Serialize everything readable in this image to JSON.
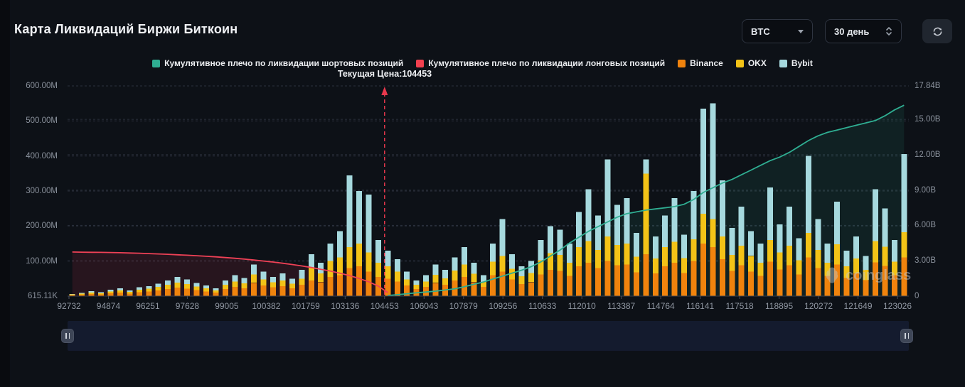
{
  "header": {
    "title": "Карта Ликвидаций Биржи Биткоин"
  },
  "controls": {
    "coin_value": "BTC",
    "period_value": "30 день",
    "refresh_icon": "refresh-icon"
  },
  "legend": [
    {
      "id": "cum-short",
      "label": "Кумулятивное плечо по ликвидации шортовых позиций",
      "color": "#2fae92"
    },
    {
      "id": "cum-long",
      "label": "Кумулятивное плечо по ликвидации лонговых позиций",
      "color": "#f2404f"
    },
    {
      "id": "binance",
      "label": "Binance",
      "color": "#f0830d"
    },
    {
      "id": "okx",
      "label": "OKX",
      "color": "#f3c317"
    },
    {
      "id": "bybit",
      "label": "Bybit",
      "color": "#a6d9de"
    }
  ],
  "annotation": {
    "current_price_label": "Текущая Цена:104453",
    "current_price": 104453
  },
  "watermark": {
    "text": "coinglass"
  },
  "chart_data": {
    "type": "bar",
    "note": "stacked liquidation bars (left axis, millions USD) + cumulative leverage lines (right axis, billions USD)",
    "x_labels": [
      "92732",
      "94874",
      "96251",
      "97628",
      "99005",
      "100382",
      "101759",
      "103136",
      "104453",
      "106043",
      "107879",
      "109256",
      "110633",
      "112010",
      "113387",
      "114764",
      "116141",
      "117518",
      "118895",
      "120272",
      "121649",
      "123026"
    ],
    "left_axis": {
      "max_m": 600,
      "ticks": [
        {
          "label": "600.00M",
          "value": 600,
          "grid": true
        },
        {
          "label": "500.00M",
          "value": 500,
          "grid": true
        },
        {
          "label": "400.00M",
          "value": 400,
          "grid": true
        },
        {
          "label": "300.00M",
          "value": 300,
          "grid": true
        },
        {
          "label": "200.00M",
          "value": 200,
          "grid": true
        },
        {
          "label": "100.00M",
          "value": 100,
          "grid": true
        },
        {
          "label": "615.11K",
          "value": 0.615,
          "grid": false
        }
      ]
    },
    "right_axis": {
      "max_b": 17.84,
      "ticks": [
        {
          "label": "17.84B",
          "value": 17.84,
          "grid": false
        },
        {
          "label": "15.00B",
          "value": 15,
          "grid": true
        },
        {
          "label": "12.00B",
          "value": 12,
          "grid": true
        },
        {
          "label": "9.00B",
          "value": 9,
          "grid": true
        },
        {
          "label": "6.00B",
          "value": 6,
          "grid": true
        },
        {
          "label": "3.00B",
          "value": 3,
          "grid": true
        },
        {
          "label": "0",
          "value": 0,
          "grid": false
        }
      ]
    },
    "price_line": {
      "label_index": 8,
      "color": "#e8384d"
    },
    "series": [
      {
        "name": "Binance",
        "color": "#f0830d",
        "unit": "M",
        "values": [
          3,
          4,
          6,
          5,
          8,
          10,
          7,
          11,
          13,
          16,
          20,
          24,
          21,
          17,
          13,
          10,
          20,
          26,
          22,
          38,
          30,
          25,
          28,
          22,
          32,
          45,
          40,
          55,
          60,
          80,
          85,
          70,
          55,
          50,
          42,
          30,
          20,
          26,
          38,
          32,
          45,
          55,
          40,
          26,
          60,
          70,
          48,
          35,
          40,
          62,
          75,
          72,
          58,
          85,
          95,
          80,
          100,
          88,
          90,
          68,
          120,
          65,
          85,
          95,
          66,
          100,
          150,
          140,
          105,
          72,
          88,
          70,
          58,
          98,
          76,
          88,
          62,
          110,
          80,
          58,
          90,
          52,
          65,
          46,
          96,
          86,
          60,
          110
        ]
      },
      {
        "name": "OKX",
        "color": "#f3c317",
        "unit": "M",
        "values": [
          2,
          3,
          4,
          3,
          5,
          6,
          5,
          7,
          8,
          10,
          12,
          15,
          13,
          10,
          9,
          6,
          12,
          16,
          14,
          24,
          18,
          15,
          17,
          13,
          18,
          35,
          25,
          45,
          50,
          60,
          65,
          55,
          40,
          35,
          28,
          18,
          12,
          16,
          23,
          19,
          28,
          35,
          24,
          15,
          38,
          45,
          30,
          22,
          26,
          40,
          48,
          46,
          37,
          55,
          62,
          52,
          70,
          58,
          60,
          45,
          230,
          42,
          55,
          60,
          43,
          62,
          85,
          80,
          65,
          46,
          56,
          45,
          37,
          62,
          49,
          56,
          40,
          70,
          52,
          37,
          58,
          33,
          42,
          29,
          61,
          55,
          38,
          72
        ]
      },
      {
        "name": "Bybit",
        "color": "#a6d9de",
        "unit": "M",
        "values": [
          1,
          2,
          4,
          3,
          5,
          6,
          4,
          7,
          7,
          9,
          13,
          16,
          14,
          11,
          8,
          6,
          13,
          18,
          16,
          28,
          22,
          15,
          20,
          15,
          25,
          40,
          30,
          50,
          75,
          205,
          150,
          165,
          65,
          45,
          35,
          22,
          13,
          18,
          29,
          24,
          37,
          50,
          31,
          19,
          52,
          105,
          42,
          28,
          34,
          58,
          77,
          72,
          55,
          100,
          148,
          98,
          220,
          114,
          130,
          67,
          40,
          63,
          90,
          125,
          66,
          138,
          300,
          330,
          160,
          77,
          111,
          70,
          55,
          150,
          80,
          111,
          63,
          220,
          88,
          55,
          122,
          45,
          63,
          40,
          148,
          109,
          62,
          223
        ]
      }
    ],
    "lines": [
      {
        "id": "cum-long",
        "name": "Кумулятивное плечо по ликвидации лонговых позиций",
        "color": "#ef4156",
        "fill": "rgba(233,58,79,0.12)",
        "axis": "right",
        "unit": "B",
        "values": [
          3.74,
          3.73,
          3.72,
          3.71,
          3.7,
          3.68,
          3.66,
          3.64,
          3.61,
          3.58,
          3.55,
          3.51,
          3.47,
          3.43,
          3.38,
          3.33,
          3.27,
          3.21,
          3.14,
          3.06,
          2.98,
          2.89,
          2.79,
          2.68,
          2.56,
          2.43,
          2.28,
          2.12,
          1.94,
          1.74,
          1.5,
          1.22,
          0.85,
          0.3,
          null,
          null,
          null,
          null,
          null,
          null,
          null,
          null,
          null,
          null,
          null,
          null,
          null,
          null,
          null,
          null,
          null,
          null,
          null,
          null,
          null,
          null,
          null,
          null,
          null,
          null,
          null,
          null,
          null,
          null,
          null,
          null,
          null,
          null,
          null,
          null,
          null,
          null,
          null,
          null,
          null,
          null,
          null,
          null,
          null,
          null,
          null,
          null,
          null,
          null,
          null,
          null,
          null,
          null
        ]
      },
      {
        "id": "cum-short",
        "name": "Кумулятивное плечо по ликвидации шортовых позиций",
        "color": "#2fae92",
        "fill": "rgba(47,174,146,0.10)",
        "axis": "right",
        "unit": "B",
        "values": [
          null,
          null,
          null,
          null,
          null,
          null,
          null,
          null,
          null,
          null,
          null,
          null,
          null,
          null,
          null,
          null,
          null,
          null,
          null,
          null,
          null,
          null,
          null,
          null,
          null,
          null,
          null,
          null,
          null,
          null,
          null,
          null,
          null,
          0.05,
          0.12,
          0.2,
          0.28,
          0.35,
          0.42,
          0.52,
          0.62,
          0.8,
          1.0,
          1.2,
          1.45,
          1.7,
          1.95,
          2.2,
          2.5,
          2.9,
          3.4,
          3.9,
          4.5,
          5.0,
          5.5,
          5.9,
          6.3,
          6.7,
          7.0,
          7.15,
          7.3,
          7.4,
          7.5,
          7.6,
          7.8,
          8.2,
          8.8,
          9.2,
          9.6,
          9.9,
          10.3,
          10.7,
          11.1,
          11.5,
          11.8,
          12.2,
          12.7,
          13.2,
          13.6,
          13.9,
          14.1,
          14.3,
          14.5,
          14.7,
          14.9,
          15.3,
          15.8,
          16.2
        ]
      }
    ]
  }
}
